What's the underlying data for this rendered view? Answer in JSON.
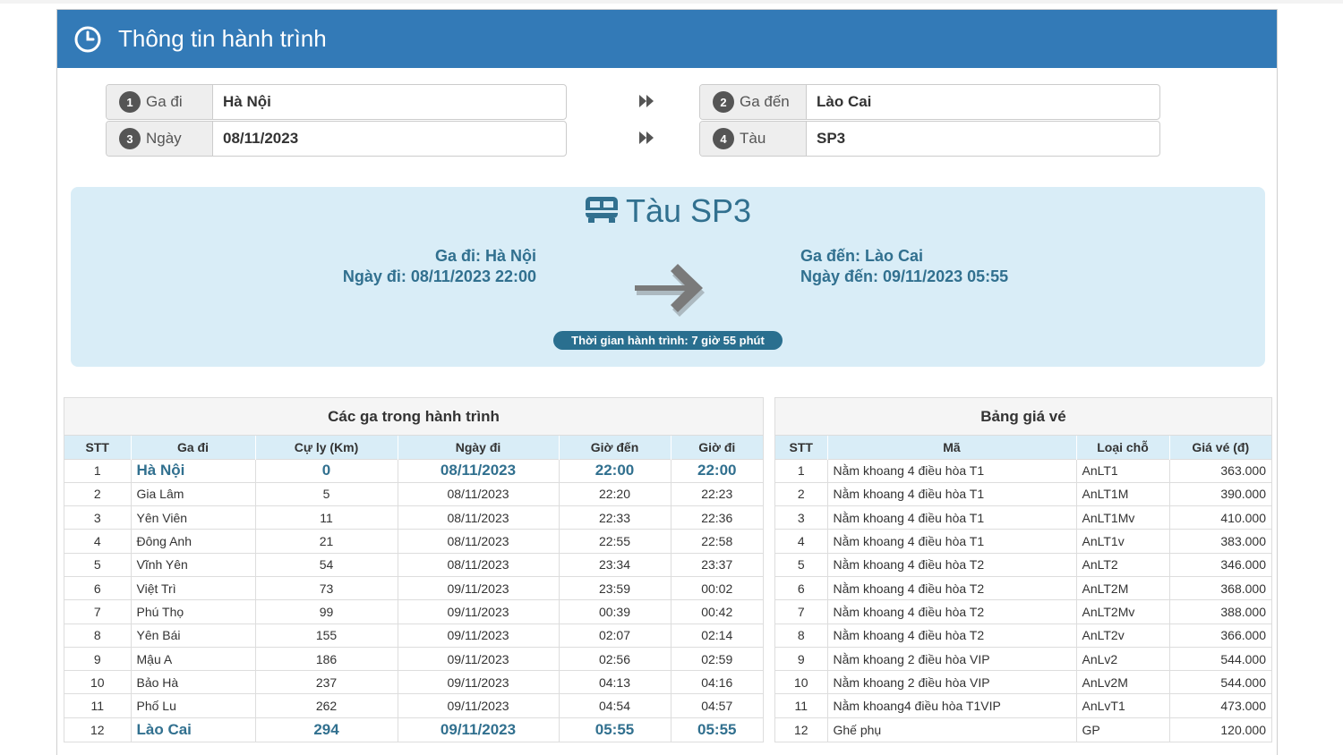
{
  "header": {
    "title": "Thông tin hành trình"
  },
  "form": {
    "from": {
      "num": "1",
      "label": "Ga đi",
      "value": "Hà Nội"
    },
    "to": {
      "num": "2",
      "label": "Ga đến",
      "value": "Lào Cai"
    },
    "date": {
      "num": "3",
      "label": "Ngày",
      "value": "08/11/2023"
    },
    "train": {
      "num": "4",
      "label": "Tàu",
      "value": "SP3"
    }
  },
  "trip": {
    "title": "Tàu SP3",
    "depart_station": "Ga đi: Hà Nội",
    "depart_time": "Ngày đi: 08/11/2023 22:00",
    "arrive_station": "Ga đến: Lào Cai",
    "arrive_time": "Ngày đến: 09/11/2023 05:55",
    "duration": "Thời gian hành trình: 7 giờ 55 phút"
  },
  "stations": {
    "title": "Các ga trong hành trình",
    "headers": [
      "STT",
      "Ga đi",
      "Cự ly (Km)",
      "Ngày đi",
      "Giờ đến",
      "Giờ đi"
    ],
    "rows": [
      [
        "1",
        "Hà Nội",
        "0",
        "08/11/2023",
        "22:00",
        "22:00"
      ],
      [
        "2",
        "Gia Lâm",
        "5",
        "08/11/2023",
        "22:20",
        "22:23"
      ],
      [
        "3",
        "Yên Viên",
        "11",
        "08/11/2023",
        "22:33",
        "22:36"
      ],
      [
        "4",
        "Đông Anh",
        "21",
        "08/11/2023",
        "22:55",
        "22:58"
      ],
      [
        "5",
        "Vĩnh Yên",
        "54",
        "08/11/2023",
        "23:34",
        "23:37"
      ],
      [
        "6",
        "Việt Trì",
        "73",
        "09/11/2023",
        "23:59",
        "00:02"
      ],
      [
        "7",
        "Phú Thọ",
        "99",
        "09/11/2023",
        "00:39",
        "00:42"
      ],
      [
        "8",
        "Yên Bái",
        "155",
        "09/11/2023",
        "02:07",
        "02:14"
      ],
      [
        "9",
        "Mậu A",
        "186",
        "09/11/2023",
        "02:56",
        "02:59"
      ],
      [
        "10",
        "Bảo Hà",
        "237",
        "09/11/2023",
        "04:13",
        "04:16"
      ],
      [
        "11",
        "Phố Lu",
        "262",
        "09/11/2023",
        "04:54",
        "04:57"
      ],
      [
        "12",
        "Lào Cai",
        "294",
        "09/11/2023",
        "05:55",
        "05:55"
      ]
    ]
  },
  "prices": {
    "title": "Bảng giá vé",
    "headers": [
      "STT",
      "Mã",
      "Loại chỗ",
      "Giá vé (đ)"
    ],
    "rows": [
      [
        "1",
        "Nằm khoang 4 điều hòa T1",
        "AnLT1",
        "363.000"
      ],
      [
        "2",
        "Nằm khoang 4 điều hòa T1",
        "AnLT1M",
        "390.000"
      ],
      [
        "3",
        "Nằm khoang 4 điều hòa T1",
        "AnLT1Mv",
        "410.000"
      ],
      [
        "4",
        "Nằm khoang 4 điều hòa T1",
        "AnLT1v",
        "383.000"
      ],
      [
        "5",
        "Nằm khoang 4 điều hòa T2",
        "AnLT2",
        "346.000"
      ],
      [
        "6",
        "Nằm khoang 4 điều hòa T2",
        "AnLT2M",
        "368.000"
      ],
      [
        "7",
        "Nằm khoang 4 điều hòa T2",
        "AnLT2Mv",
        "388.000"
      ],
      [
        "8",
        "Nằm khoang 4 điều hòa T2",
        "AnLT2v",
        "366.000"
      ],
      [
        "9",
        "Nằm khoang 2 điều hòa VIP",
        "AnLv2",
        "544.000"
      ],
      [
        "10",
        "Nằm khoang 2 điều hòa VIP",
        "AnLv2M",
        "544.000"
      ],
      [
        "11",
        "Nằm khoang4 điều hòa T1VIP",
        "AnLvT1",
        "473.000"
      ],
      [
        "12",
        "Ghế phụ",
        "GP",
        "120.000"
      ]
    ]
  },
  "colors": {
    "header_bg": "#337ab7",
    "info_bg": "#d9edf7",
    "info_text": "#31708f"
  },
  "icons": {
    "header": "clock-icon",
    "train": "train-icon",
    "arrow": "arrow-right-icon",
    "forward": "forward-icon"
  }
}
